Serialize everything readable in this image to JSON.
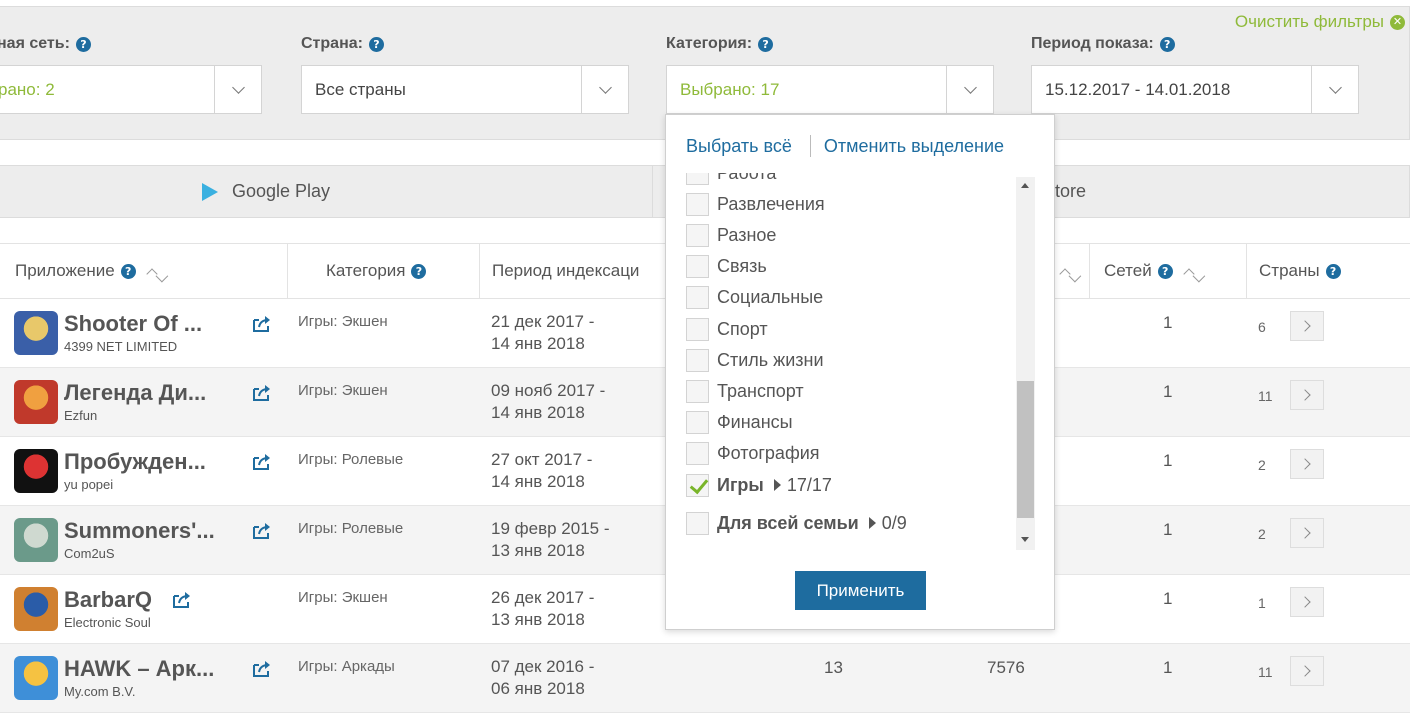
{
  "filters": {
    "clear_label": "Очистить фильтры",
    "network": {
      "label": "ная сеть:",
      "value": "рано: 2"
    },
    "country": {
      "label": "Страна:",
      "value": "Все страны"
    },
    "category": {
      "label": "Категория:",
      "value": "Выбрано: 17"
    },
    "period": {
      "label": "Период показа:",
      "value": "15.12.2017 - 14.01.2018"
    }
  },
  "tabs": {
    "google_play": "Google Play",
    "app_store": "tore"
  },
  "table": {
    "headers": {
      "app": "Приложение",
      "category": "Категория",
      "period": "Период индексаци",
      "networks": "Сетей",
      "countries": "Страны"
    },
    "rows": [
      {
        "name": "Shooter Of ...",
        "developer": "4399 NET LIMITED",
        "category": "Игры: Экшен",
        "period_start": "21 дек 2017 -",
        "period_end": "14 янв 2018",
        "col4": "",
        "col5": "",
        "networks": "1",
        "countries": "6"
      },
      {
        "name": "Легенда Ди...",
        "developer": "Ezfun",
        "category": "Игры: Экшен",
        "period_start": "09 нояб 2017 -",
        "period_end": "14 янв 2018",
        "col4": "",
        "col5": "",
        "networks": "1",
        "countries": "11"
      },
      {
        "name": "Пробужден...",
        "developer": "yu popei",
        "category": "Игры: Ролевые",
        "period_start": "27 окт 2017 -",
        "period_end": "14 янв 2018",
        "col4": "",
        "col5": "",
        "networks": "1",
        "countries": "2"
      },
      {
        "name": "Summoners'...",
        "developer": "Com2uS",
        "category": "Игры: Ролевые",
        "period_start": "19 февр 2015 -",
        "period_end": "13 янв 2018",
        "col4": "",
        "col5": "",
        "networks": "1",
        "countries": "2"
      },
      {
        "name": "BarbarQ",
        "developer": "Electronic Soul",
        "category": "Игры: Экшен",
        "period_start": "26 дек 2017 -",
        "period_end": "13 янв 2018",
        "col4": "",
        "col5": "",
        "networks": "1",
        "countries": "1"
      },
      {
        "name": "HAWK – Арк...",
        "developer": "My.com B.V.",
        "category": "Игры: Аркады",
        "period_start": "07 дек 2016 -",
        "period_end": "06 янв 2018",
        "col4": "13",
        "col5": "7576",
        "networks": "1",
        "countries": "11"
      }
    ]
  },
  "dropdown": {
    "select_all": "Выбрать всё",
    "deselect_all": "Отменить выделение",
    "items": [
      {
        "label": "Работа",
        "checked": false
      },
      {
        "label": "Развлечения",
        "checked": false
      },
      {
        "label": "Разное",
        "checked": false
      },
      {
        "label": "Связь",
        "checked": false
      },
      {
        "label": "Социальные",
        "checked": false
      },
      {
        "label": "Спорт",
        "checked": false
      },
      {
        "label": "Стиль жизни",
        "checked": false
      },
      {
        "label": "Транспорт",
        "checked": false
      },
      {
        "label": "Финансы",
        "checked": false
      },
      {
        "label": "Фотография",
        "checked": false
      }
    ],
    "groups": [
      {
        "label": "Игры",
        "count": "17/17",
        "checked": true
      },
      {
        "label": "Для всей семьи",
        "count": "0/9",
        "checked": false
      }
    ],
    "apply_label": "Применить"
  },
  "colors": {
    "accent_green": "#8fba3a",
    "link_blue": "#1e6c9f",
    "panel_bg": "#ededed"
  }
}
